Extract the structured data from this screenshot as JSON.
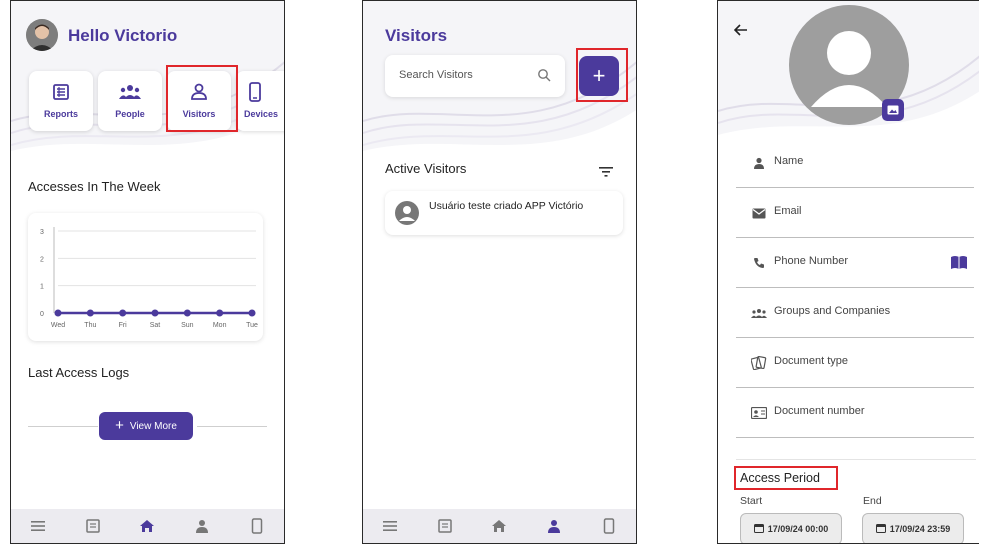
{
  "home": {
    "greeting": "Hello Victorio",
    "tiles": [
      {
        "label": "Reports",
        "icon": "reports-icon"
      },
      {
        "label": "People",
        "icon": "people-icon"
      },
      {
        "label": "Visitors",
        "icon": "visitor-icon"
      },
      {
        "label": "Devices",
        "icon": "device-icon"
      }
    ],
    "accesses_title": "Accesses In The Week",
    "last_logs_title": "Last Access Logs",
    "view_more_label": "View More"
  },
  "chart_data": {
    "type": "line",
    "categories": [
      "Wed",
      "Thu",
      "Fri",
      "Sat",
      "Sun",
      "Mon",
      "Tue"
    ],
    "series": [
      {
        "values": [
          0,
          0,
          0,
          0,
          0,
          0,
          0
        ]
      }
    ],
    "yticks": [
      "0",
      "1",
      "2",
      "3"
    ],
    "ylim": [
      0,
      3
    ],
    "grid": true,
    "color": "#4b3a9c"
  },
  "visitors": {
    "title": "Visitors",
    "search_placeholder": "Search Visitors",
    "add_label": "+",
    "active_title": "Active Visitors",
    "list": [
      {
        "name": "Usuário teste criado APP Victório"
      }
    ]
  },
  "form": {
    "fields": [
      {
        "label": "Name",
        "icon": "person-icon"
      },
      {
        "label": "Email",
        "icon": "email-icon"
      },
      {
        "label": "Phone Number",
        "icon": "phone-icon"
      },
      {
        "label": "Groups and Companies",
        "icon": "groups-icon"
      },
      {
        "label": "Document type",
        "icon": "document-type-icon"
      },
      {
        "label": "Document number",
        "icon": "id-card-icon"
      }
    ],
    "access_period_title": "Access Period",
    "start_label": "Start",
    "end_label": "End",
    "start_value": "17/09/24 00:00",
    "end_value": "17/09/24 23:59"
  },
  "bottom_nav": [
    "menu-icon",
    "reports-icon",
    "home-icon",
    "person-icon",
    "device-icon"
  ],
  "colors": {
    "accent": "#4b3a9c",
    "highlight": "#e0262b",
    "nav_bg": "#ecebf0"
  }
}
